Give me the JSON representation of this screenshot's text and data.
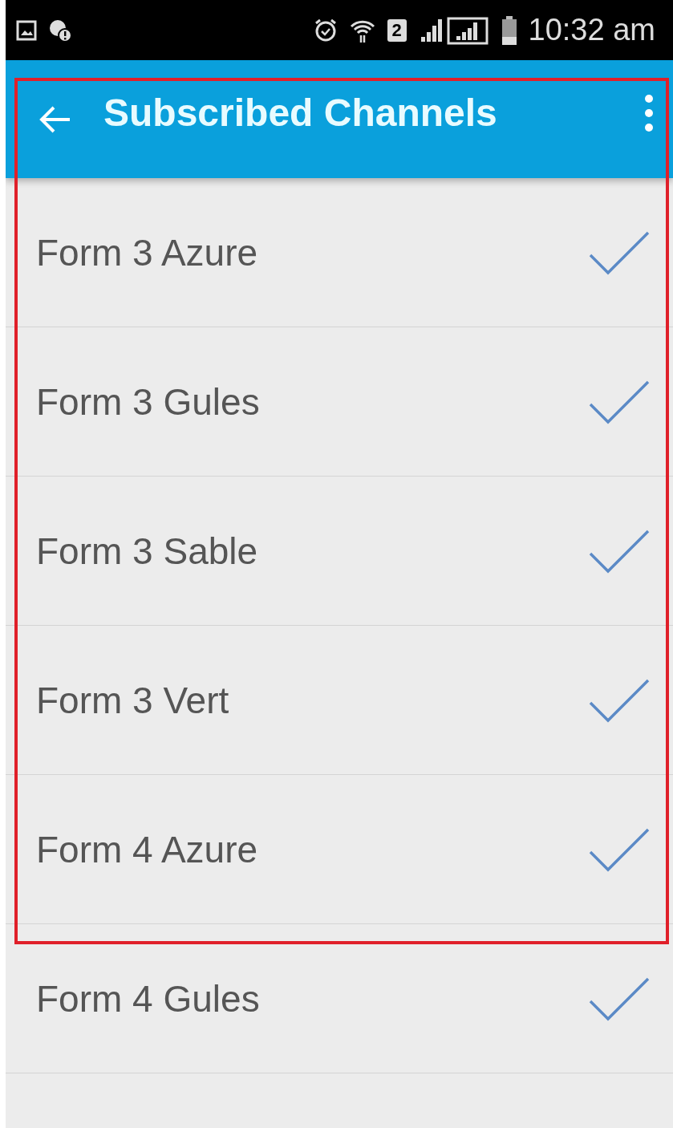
{
  "status_bar": {
    "time": "10:32 am",
    "sim_slot": "2"
  },
  "app_bar": {
    "title": "Subscribed Channels"
  },
  "channels": [
    {
      "label": "Form 3 Azure",
      "checked": true
    },
    {
      "label": "Form 3 Gules",
      "checked": true
    },
    {
      "label": "Form 3 Sable",
      "checked": true
    },
    {
      "label": "Form 3 Vert",
      "checked": true
    },
    {
      "label": "Form 4 Azure",
      "checked": true
    },
    {
      "label": "Form 4 Gules",
      "checked": true
    }
  ],
  "annotation": {
    "kind": "frame"
  }
}
